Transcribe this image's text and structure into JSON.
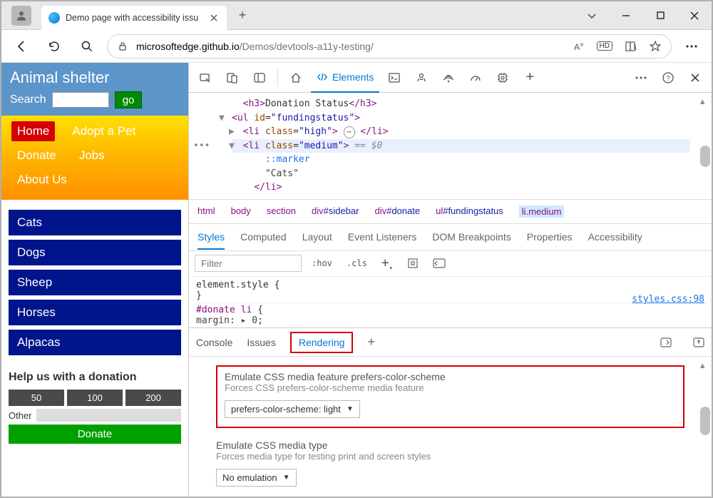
{
  "browser": {
    "tab_title": "Demo page with accessibility issu",
    "url_host": "microsoftedge.github.io",
    "url_path": "/Demos/devtools-a11y-testing/"
  },
  "page": {
    "title": "Animal shelter",
    "search_label": "Search",
    "go_label": "go",
    "nav": [
      "Home",
      "Adopt a Pet",
      "Donate",
      "Jobs",
      "About Us"
    ],
    "sidebar": [
      "Cats",
      "Dogs",
      "Sheep",
      "Horses",
      "Alpacas"
    ],
    "donate_heading": "Help us with a donation",
    "amounts": [
      "50",
      "100",
      "200"
    ],
    "other_label": "Other",
    "donate_button": "Donate"
  },
  "devtools": {
    "main_tab": "Elements",
    "dom": {
      "h3_text": "Donation Status",
      "ul_id": "fundingstatus",
      "li_high_class": "high",
      "li_medium_class": "medium",
      "dollar": "== $0",
      "marker": "::marker",
      "cats": "\"Cats\""
    },
    "breadcrumb": [
      "html",
      "body",
      "section",
      "div#sidebar",
      "div#donate",
      "ul#fundingstatus",
      "li.medium"
    ],
    "style_tabs": [
      "Styles",
      "Computed",
      "Layout",
      "Event Listeners",
      "DOM Breakpoints",
      "Properties",
      "Accessibility"
    ],
    "filter_placeholder": "Filter",
    "hov": ":hov",
    "cls": ".cls",
    "styles": {
      "element_style": "element.style {",
      "close": "}",
      "rule_sel": "#donate li",
      "rule_open": " {",
      "rule_body": "  margin: ▸ 0;",
      "source": "styles.css:98"
    },
    "drawer_tabs": [
      "Console",
      "Issues",
      "Rendering"
    ],
    "rendering": {
      "pcs_title": "Emulate CSS media feature prefers-color-scheme",
      "pcs_sub": "Forces CSS prefers-color-scheme media feature",
      "pcs_value": "prefers-color-scheme: light",
      "mt_title": "Emulate CSS media type",
      "mt_sub": "Forces media type for testing print and screen styles",
      "mt_value": "No emulation"
    }
  }
}
